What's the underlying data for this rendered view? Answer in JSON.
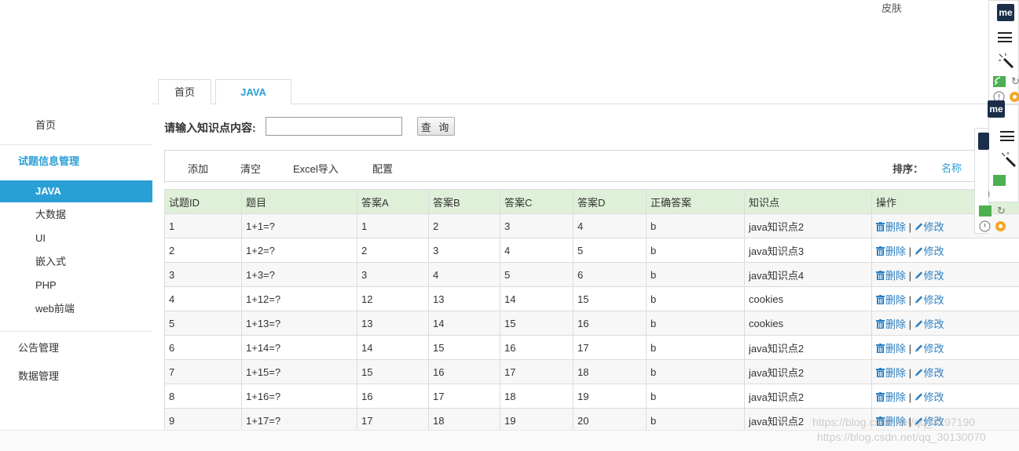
{
  "header": {
    "skin": "皮肤"
  },
  "tabs": [
    {
      "label": "首页"
    },
    {
      "label": "JAVA"
    }
  ],
  "sidebar": {
    "home": "首页",
    "group1": "试题信息管理",
    "items": [
      "JAVA",
      "大数据",
      "UI",
      "嵌入式",
      "PHP",
      "web前端"
    ],
    "group2": "公告管理",
    "group3": "数据管理"
  },
  "search": {
    "label": "请输入知识点内容:",
    "value": "",
    "button": "查 询"
  },
  "toolbar": {
    "add": "添加",
    "clear": "清空",
    "import": "Excel导入",
    "config": "配置",
    "sort_label": "排序：",
    "sort_name": "名称"
  },
  "table": {
    "headers": [
      "试题ID",
      "题目",
      "答案A",
      "答案B",
      "答案C",
      "答案D",
      "正确答案",
      "知识点",
      "操作"
    ],
    "delete_label": "删除",
    "edit_label": "修改",
    "separator": "|",
    "rows": [
      [
        "1",
        "1+1=?",
        "1",
        "2",
        "3",
        "4",
        "b",
        "java知识点2"
      ],
      [
        "2",
        "1+2=?",
        "2",
        "3",
        "4",
        "5",
        "b",
        "java知识点3"
      ],
      [
        "3",
        "1+3=?",
        "3",
        "4",
        "5",
        "6",
        "b",
        "java知识点4"
      ],
      [
        "4",
        "1+12=?",
        "12",
        "13",
        "14",
        "15",
        "b",
        "cookies"
      ],
      [
        "5",
        "1+13=?",
        "13",
        "14",
        "15",
        "16",
        "b",
        "cookies"
      ],
      [
        "6",
        "1+14=?",
        "14",
        "15",
        "16",
        "17",
        "b",
        "java知识点2"
      ],
      [
        "7",
        "1+15=?",
        "15",
        "16",
        "17",
        "18",
        "b",
        "java知识点2"
      ],
      [
        "8",
        "1+16=?",
        "16",
        "17",
        "18",
        "19",
        "b",
        "java知识点2"
      ],
      [
        "9",
        "1+17=?",
        "17",
        "18",
        "19",
        "20",
        "b",
        "java知识点2"
      ]
    ]
  },
  "widgets": {
    "me_badge": "me"
  },
  "watermark": {
    "line1": "https://blog.csdn.net/qq_3797190",
    "line2": "https://blog.csdn.net/qq_30130070"
  },
  "colors": {
    "accent": "#2a9fd6",
    "header_bg": "#dff0d8",
    "link": "#2a7fc4"
  }
}
